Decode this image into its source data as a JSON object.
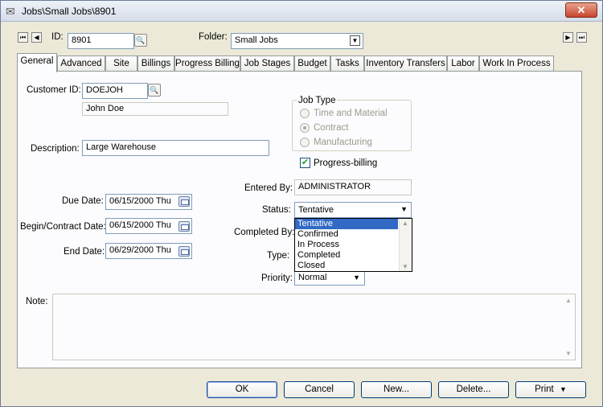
{
  "window": {
    "title": "Jobs\\Small Jobs\\8901",
    "close_glyph": "✕"
  },
  "header": {
    "id_label": "ID:",
    "id_value": "8901",
    "folder_label": "Folder:",
    "folder_value": "Small Jobs"
  },
  "tabs": [
    {
      "label": "General"
    },
    {
      "label": "Advanced"
    },
    {
      "label": "Site"
    },
    {
      "label": "Billings"
    },
    {
      "label": "Progress Billing"
    },
    {
      "label": "Job Stages"
    },
    {
      "label": "Budget"
    },
    {
      "label": "Tasks"
    },
    {
      "label": "Inventory Transfers"
    },
    {
      "label": "Labor"
    },
    {
      "label": "Work In Process"
    }
  ],
  "general": {
    "customer_id_label": "Customer ID:",
    "customer_id_value": "DOEJOH",
    "customer_name": "John Doe",
    "description_label": "Description:",
    "description_value": "Large Warehouse",
    "job_type_label": "Job Type",
    "job_type_options": [
      "Time and Material",
      "Contract",
      "Manufacturing"
    ],
    "progress_billing_label": "Progress-billing",
    "entered_by_label": "Entered By:",
    "entered_by_value": "ADMINISTRATOR",
    "status_label": "Status:",
    "status_value": "Tentative",
    "status_options": [
      "Tentative",
      "Confirmed",
      "In Process",
      "Completed",
      "Closed"
    ],
    "completed_by_label": "Completed By:",
    "type_label": "Type:",
    "priority_label": "Priority:",
    "priority_value": "Normal",
    "due_date_label": "Due Date:",
    "due_date_value": "06/15/2000 Thu",
    "begin_date_label": "Begin/Contract Date:",
    "begin_date_value": "06/15/2000 Thu",
    "end_date_label": "End Date:",
    "end_date_value": "06/29/2000 Thu",
    "note_label": "Note:"
  },
  "buttons": {
    "ok": "OK",
    "cancel": "Cancel",
    "new": "New...",
    "delete": "Delete...",
    "print": "Print"
  }
}
